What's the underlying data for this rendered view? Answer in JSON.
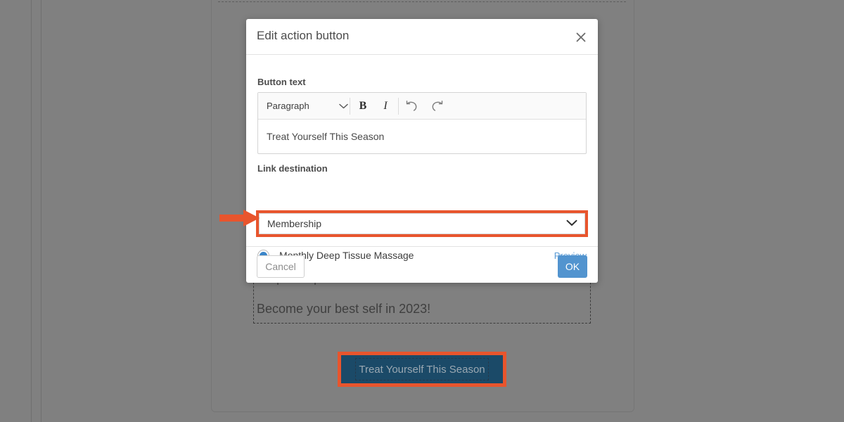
{
  "modal": {
    "title": "Edit action button",
    "close_icon": "close-icon",
    "button_text": {
      "label": "Button text",
      "toolbar": {
        "format_select_value": "Paragraph",
        "format_select_icon": "chevron-down-icon",
        "bold_label": "B",
        "italic_label": "I",
        "undo_icon": "undo-icon",
        "redo_icon": "redo-icon"
      },
      "content_value": "Treat Yourself This Season"
    },
    "link_destination": {
      "label": "Link destination",
      "select_value": "Membership",
      "select_icon": "chevron-down-icon",
      "option": {
        "label": "Monthly Deep Tissue Massage",
        "selected": true,
        "preview_label": "Preview"
      }
    },
    "footer": {
      "cancel_label": "Cancel",
      "ok_label": "OK"
    }
  },
  "background": {
    "text_line_1": "simple steps.",
    "text_line_2": "Become your best self in 2023!",
    "cta_button_label": "Treat Yourself This Season"
  },
  "annotations": {
    "arrow_icon": "arrow-right-icon",
    "highlight_color": "#e8552d"
  },
  "colors": {
    "overlay": "#808080",
    "modal_background": "#ffffff",
    "accent_blue": "#5294cf",
    "link_blue": "#5b9bd5",
    "radio_blue": "#3b86c9",
    "annotation_orange": "#e8552d",
    "cta_button_background": "#1b4a68"
  }
}
